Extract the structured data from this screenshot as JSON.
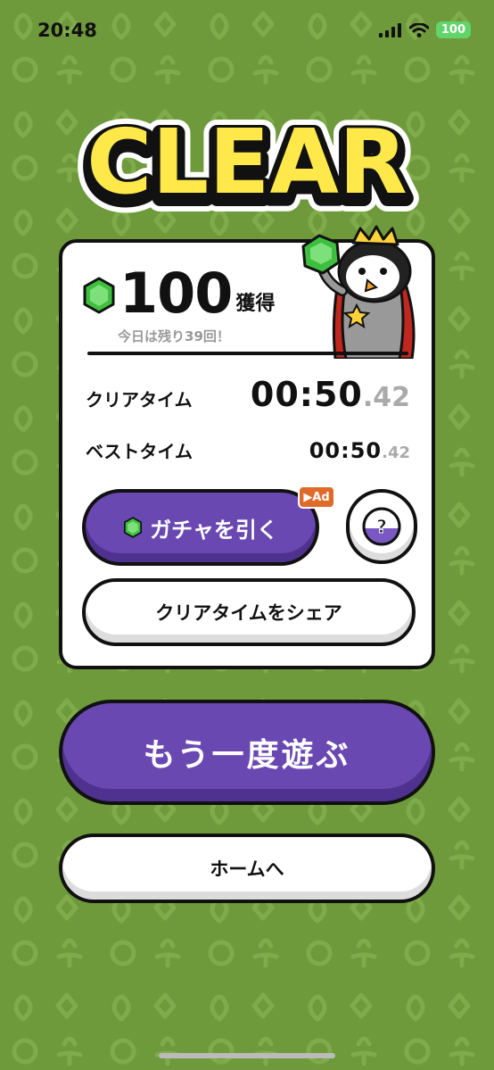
{
  "status_bar": {
    "time": "20:48",
    "battery": "100"
  },
  "title": "CLEAR",
  "result": {
    "gem_amount": "100",
    "gem_suffix": "獲得",
    "remaining_text": "今日は残り39回！",
    "clear_time_label": "クリアタイム",
    "clear_time_main": "00:50",
    "clear_time_ms": ".42",
    "best_time_label": "ベストタイム",
    "best_time_main": "00:50",
    "best_time_ms": ".42"
  },
  "buttons": {
    "gacha": "ガチャを引く",
    "ad_badge": "▶Ad",
    "share": "クリアタイムをシェア",
    "replay": "もう一度遊ぶ",
    "home": "ホームへ"
  },
  "colors": {
    "background": "#6e9a3c",
    "purple": "#6a48b2",
    "title_yellow": "#ffe94a",
    "gem_green": "#3fbf3f"
  },
  "icons": [
    "signal-icon",
    "wifi-icon",
    "gem-icon",
    "question-icon",
    "penguin-king-mascot"
  ]
}
